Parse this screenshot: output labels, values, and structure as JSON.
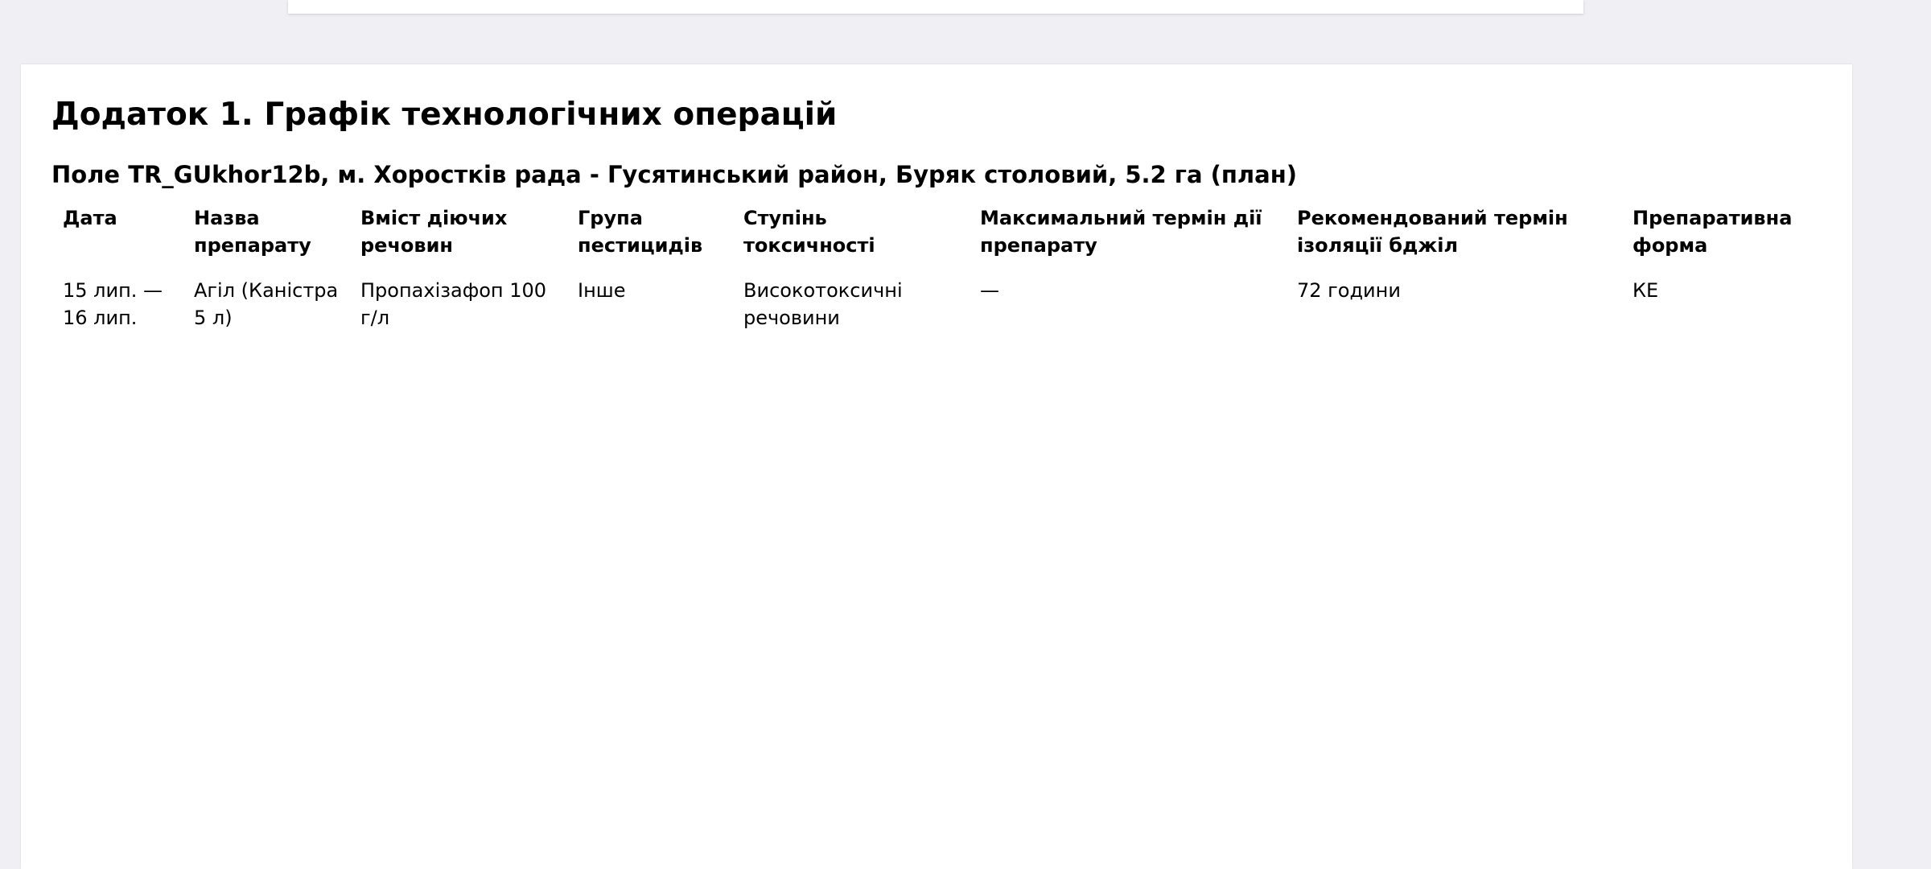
{
  "document": {
    "appendix_title": "Додаток 1. Графік технологічних операцій",
    "field_title": "Поле TR_GUkhor12b, м. Хоростків рада - Гусятинський район, Буряк столовий, 5.2 га (план)"
  },
  "table": {
    "headers": [
      "Дата",
      "Назва препарату",
      "Вміст діючих речовин",
      "Група пестицидів",
      "Ступінь токсичності",
      "Максимальний термін дії препарату",
      "Рекомендований термін ізоляції бджіл",
      "Препаративна форма"
    ],
    "rows": [
      [
        "15 лип. — 16 лип.",
        "Агіл (Каністра 5 л)",
        "Пропахізафоп 100 г/л",
        "Інше",
        "Високотоксичні речовини",
        "—",
        "72 години",
        "КЕ"
      ]
    ]
  }
}
